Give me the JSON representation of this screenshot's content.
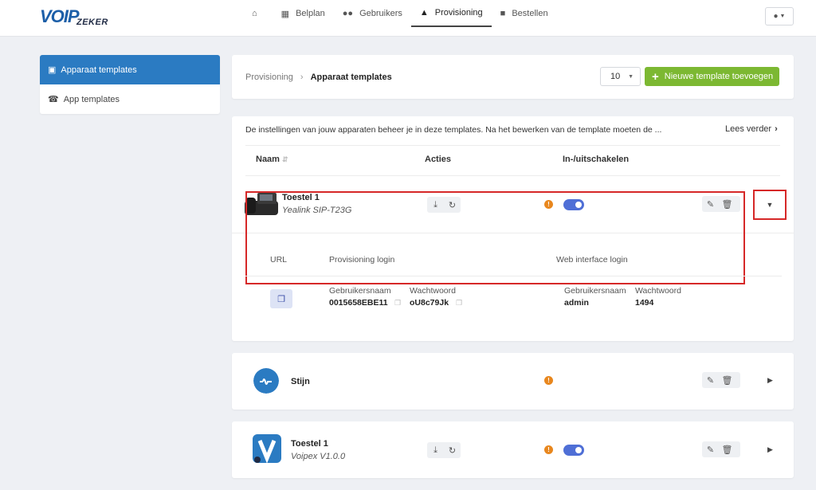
{
  "brand": {
    "logo_main": "VOIP",
    "logo_sub": "ZEKER",
    "primary": "#2b7bc2",
    "accent_green": "#7cb832",
    "highlight_red": "#d62828"
  },
  "nav": [
    {
      "icon": "home-icon",
      "label": ""
    },
    {
      "icon": "sitemap-icon",
      "label": "Belplan"
    },
    {
      "icon": "users-icon",
      "label": "Gebruikers"
    },
    {
      "icon": "provisioning-icon",
      "label": "Provisioning"
    },
    {
      "icon": "cart-icon",
      "label": "Bestellen"
    }
  ],
  "sidebar": {
    "items": [
      {
        "icon": "template-icon",
        "label": "Apparaat templates"
      },
      {
        "icon": "phone-icon",
        "label": "App templates"
      }
    ]
  },
  "toolbar": {
    "breadcrumb_root": "Provisioning",
    "breadcrumb_current": "Apparaat templates",
    "page_size": "10",
    "add_label": "Nieuwe template toevoegen"
  },
  "list": {
    "info": "De instellingen van jouw apparaten beheer je in deze templates. Na het bewerken van de template moeten de ...",
    "read_more": "Lees verder",
    "headers": {
      "name": "Naam",
      "actions": "Acties",
      "toggle": "In-/uitschakelen"
    }
  },
  "rows": [
    {
      "name": "Toestel 1",
      "model": "Yealink SIP-T23G",
      "enabled": true
    },
    {
      "name": "Stijn",
      "model": ""
    },
    {
      "name": "Toestel 1",
      "model": "Voipex V1.0.0",
      "enabled": true
    }
  ],
  "details": {
    "url_label": "URL",
    "prov_label": "Provisioning login",
    "web_label": "Web interface login",
    "prov_user_label": "Gebruikersnaam",
    "prov_pass_label": "Wachtwoord",
    "prov_user": "0015658EBE11",
    "prov_pass": "oU8c79Jk",
    "web_user_label": "Gebruikersnaam",
    "web_pass_label": "Wachtwoord",
    "web_user": "admin",
    "web_pass": "1494"
  }
}
